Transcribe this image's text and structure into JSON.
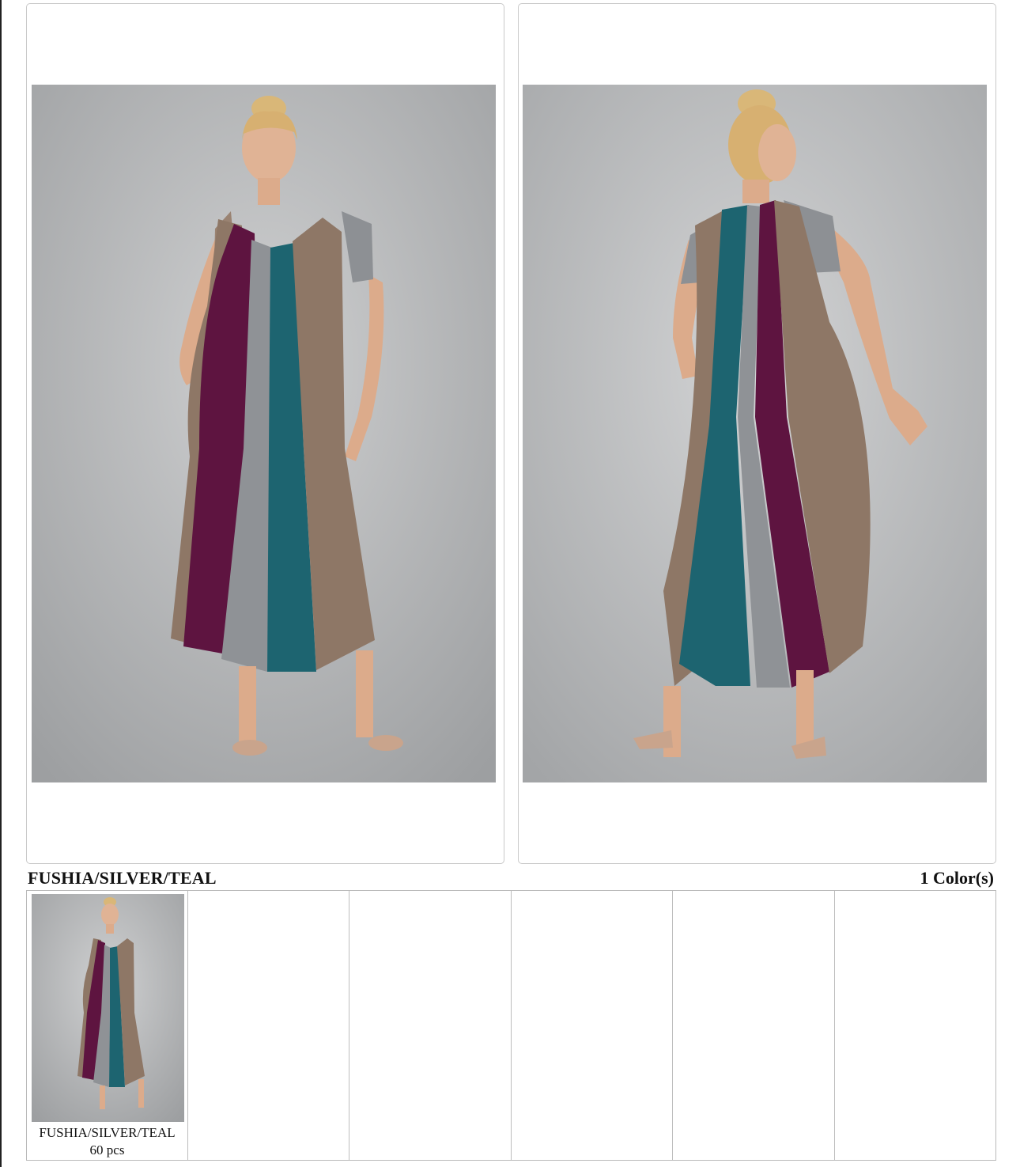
{
  "photos": {
    "front": "model-front-photo",
    "back": "model-back-photo"
  },
  "colors": {
    "fuchsia": "#5e1440",
    "silver": "#8f9296",
    "teal": "#1d6470",
    "taupe": "#8e7766",
    "backdrop": "#b8b9ba"
  },
  "color_section": {
    "title": "FUSHIA/SILVER/TEAL",
    "count_label": "1 Color(s)"
  },
  "swatches": [
    {
      "name": "FUSHIA/SILVER/TEAL",
      "quantity": "60 pcs"
    }
  ]
}
